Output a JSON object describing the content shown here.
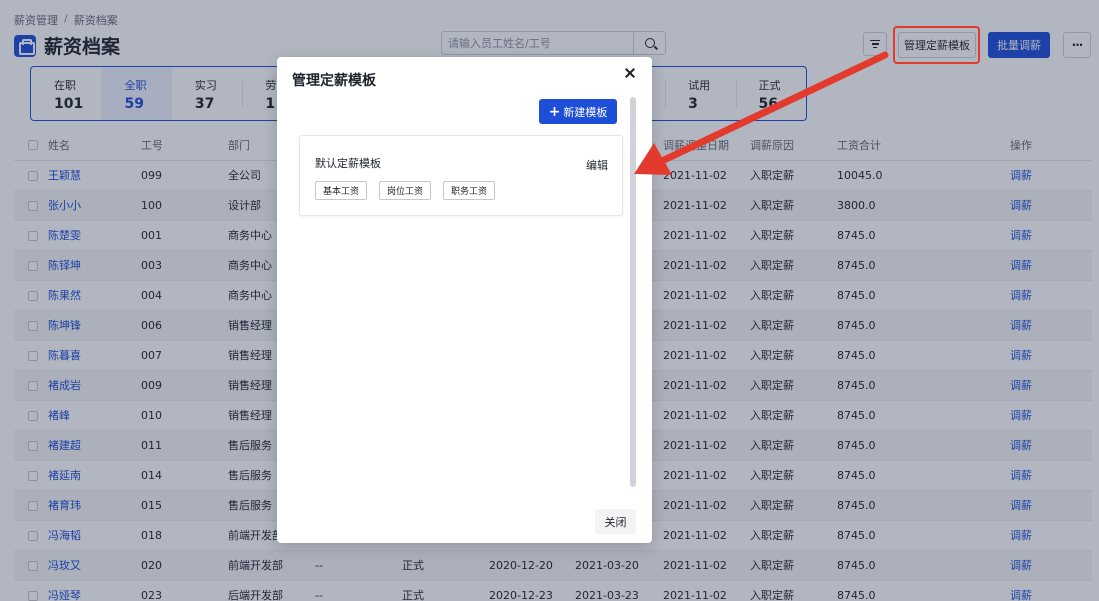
{
  "breadcrumb": [
    "薪资管理",
    "薪资档案"
  ],
  "breadcrumb_sep": "/",
  "page_title": "薪资档案",
  "search": {
    "placeholder": "请输入员工姓名/工号"
  },
  "toolbar": {
    "manage_label": "管理定薪模板",
    "batch_label": "批量调薪",
    "more_label": "···"
  },
  "stats": [
    {
      "label": "在职",
      "count": "101"
    },
    {
      "label": "全职",
      "count": "59"
    },
    {
      "label": "实习",
      "count": "37"
    },
    {
      "label": "劳",
      "count": "1"
    },
    {
      "label": "",
      "count": ""
    },
    {
      "label": "",
      "count": ""
    },
    {
      "label": "",
      "count": ""
    },
    {
      "label": "",
      "count": ""
    },
    {
      "label": "",
      "count": ""
    },
    {
      "label": "试用",
      "count": "3"
    },
    {
      "label": "正式",
      "count": "56"
    }
  ],
  "table": {
    "headers": [
      "姓名",
      "工号",
      "部门",
      "",
      "",
      "",
      "调薪调整日期",
      "调薪原因",
      "工资合计",
      "操作"
    ],
    "rows": [
      [
        "王颖慧",
        "099",
        "全公司",
        "",
        "",
        "",
        "2021-11-02",
        "入职定薪",
        "10045.0",
        "调薪"
      ],
      [
        "张小小",
        "100",
        "设计部",
        "",
        "",
        "",
        "2021-11-02",
        "入职定薪",
        "3800.0",
        "调薪"
      ],
      [
        "陈楚雯",
        "001",
        "商务中心",
        "",
        "",
        "",
        "2021-11-02",
        "入职定薪",
        "8745.0",
        "调薪"
      ],
      [
        "陈铎坤",
        "003",
        "商务中心",
        "",
        "",
        "",
        "2021-11-02",
        "入职定薪",
        "8745.0",
        "调薪"
      ],
      [
        "陈果然",
        "004",
        "商务中心",
        "",
        "",
        "",
        "2021-11-02",
        "入职定薪",
        "8745.0",
        "调薪"
      ],
      [
        "陈坤锋",
        "006",
        "销售经理",
        "",
        "",
        "",
        "2021-11-02",
        "入职定薪",
        "8745.0",
        "调薪"
      ],
      [
        "陈暮喜",
        "007",
        "销售经理",
        "",
        "",
        "",
        "2021-11-02",
        "入职定薪",
        "8745.0",
        "调薪"
      ],
      [
        "褚成岩",
        "009",
        "销售经理",
        "",
        "",
        "",
        "2021-11-02",
        "入职定薪",
        "8745.0",
        "调薪"
      ],
      [
        "褚峰",
        "010",
        "销售经理",
        "",
        "",
        "",
        "2021-11-02",
        "入职定薪",
        "8745.0",
        "调薪"
      ],
      [
        "褚建超",
        "011",
        "售后服务",
        "",
        "",
        "",
        "2021-11-02",
        "入职定薪",
        "8745.0",
        "调薪"
      ],
      [
        "褚延南",
        "014",
        "售后服务",
        "",
        "",
        "",
        "2021-11-02",
        "入职定薪",
        "8745.0",
        "调薪"
      ],
      [
        "褚育玮",
        "015",
        "售后服务",
        "",
        "",
        "",
        "2021-11-02",
        "入职定薪",
        "8745.0",
        "调薪"
      ],
      [
        "冯海韬",
        "018",
        "前端开发部",
        "",
        "",
        "",
        "2021-11-02",
        "入职定薪",
        "8745.0",
        "调薪"
      ],
      [
        "冯玫又",
        "020",
        "前端开发部",
        "--",
        "正式",
        "2020-12-20",
        "2021-03-20",
        "2021-11-02",
        "入职定薪",
        "8745.0",
        "调薪"
      ],
      [
        "冯娅琴",
        "023",
        "后端开发部",
        "--",
        "正式",
        "2020-12-23",
        "2021-03-23",
        "2021-11-02",
        "入职定薪",
        "8745.0",
        "调薪"
      ]
    ]
  },
  "modal": {
    "title": "管理定薪模板",
    "new_label": "新建模板",
    "template": {
      "name": "默认定薪模板",
      "edit_label": "编辑",
      "tags": [
        "基本工资",
        "岗位工资",
        "职务工资"
      ]
    },
    "close_label": "关闭"
  },
  "colors": {
    "primary": "#1d4ed8",
    "annotation": "#e23b2e"
  }
}
